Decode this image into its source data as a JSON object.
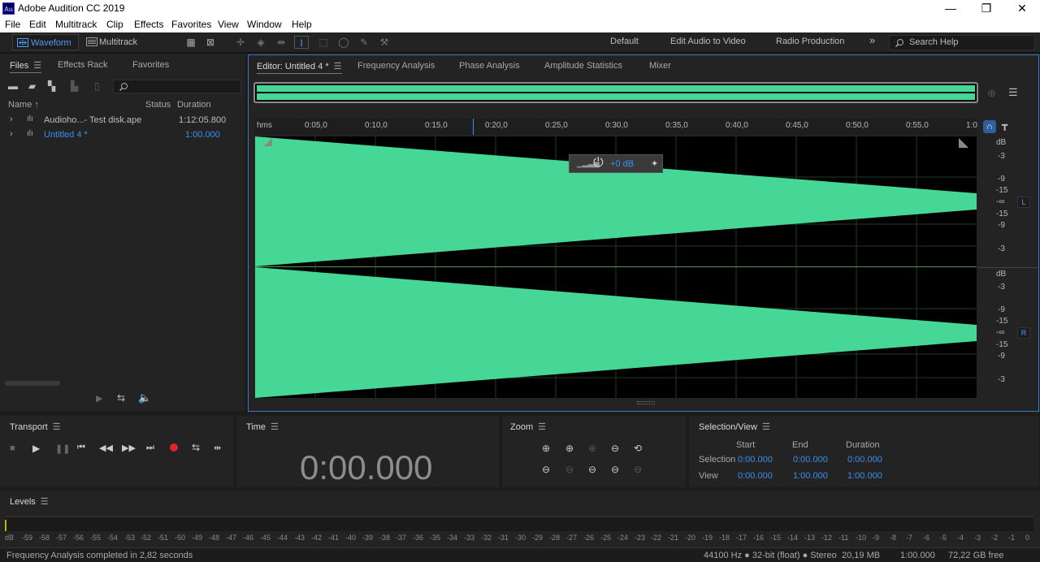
{
  "app": {
    "title": "Adobe Audition CC 2019",
    "icon_text": "Au"
  },
  "window_controls": {
    "minimize": "—",
    "maximize": "❐",
    "close": "✕"
  },
  "menu": [
    "File",
    "Edit",
    "Multitrack",
    "Clip",
    "Effects",
    "Favorites",
    "View",
    "Window",
    "Help"
  ],
  "toolbar": {
    "waveform": "Waveform",
    "multitrack": "Multitrack",
    "workspaces": [
      "Default",
      "Edit Audio to Video",
      "Radio Production"
    ],
    "more": "»",
    "search_placeholder": "Search Help"
  },
  "files_panel": {
    "tabs": [
      "Files",
      "Effects Rack",
      "Favorites"
    ],
    "columns": {
      "name": "Name",
      "status": "Status",
      "duration": "Duration"
    },
    "rows": [
      {
        "name": "Audioho...- Test disk.ape",
        "status": "",
        "duration": "1:12:05.800",
        "active": false
      },
      {
        "name": "Untitled 4 *",
        "status": "",
        "duration": "1:00.000",
        "active": true
      }
    ]
  },
  "editor": {
    "tabs": [
      "Editor: Untitled 4 *",
      "Frequency Analysis",
      "Phase Analysis",
      "Amplitude Statistics",
      "Mixer"
    ],
    "ruler": [
      "hms",
      "0:05,0",
      "0:10,0",
      "0:15,0",
      "0:20,0",
      "0:25,0",
      "0:30,0",
      "0:35,0",
      "0:40,0",
      "0:45,0",
      "0:50,0",
      "0:55,0",
      "1:0"
    ],
    "hud_value": "+0 dB",
    "db_scale_top": [
      "dB",
      "-3",
      "-9",
      "-15",
      "-∞",
      "-15",
      "-9",
      "-3"
    ],
    "db_scale_bottom": [
      "dB",
      "-3",
      "-9",
      "-15",
      "-∞",
      "-15",
      "-9",
      "-3"
    ],
    "channel_left": "L",
    "channel_right": "R",
    "waveform_color": "#46d797"
  },
  "transport": {
    "title": "Transport"
  },
  "time": {
    "title": "Time",
    "value": "0:00.000"
  },
  "zoom": {
    "title": "Zoom"
  },
  "selection_view": {
    "title": "Selection/View",
    "headers": [
      "Start",
      "End",
      "Duration"
    ],
    "rows": [
      {
        "label": "Selection",
        "start": "0:00.000",
        "end": "0:00.000",
        "duration": "0:00.000"
      },
      {
        "label": "View",
        "start": "0:00.000",
        "end": "1:00.000",
        "duration": "1:00.000"
      }
    ]
  },
  "levels": {
    "title": "Levels",
    "scale": [
      "dB",
      "-59",
      "-58",
      "-57",
      "-56",
      "-55",
      "-54",
      "-53",
      "-52",
      "-51",
      "-50",
      "-49",
      "-48",
      "-47",
      "-46",
      "-45",
      "-44",
      "-43",
      "-42",
      "-41",
      "-40",
      "-39",
      "-38",
      "-37",
      "-36",
      "-35",
      "-34",
      "-33",
      "-32",
      "-31",
      "-30",
      "-29",
      "-28",
      "-27",
      "-26",
      "-25",
      "-24",
      "-23",
      "-22",
      "-21",
      "-20",
      "-19",
      "-18",
      "-17",
      "-16",
      "-15",
      "-14",
      "-13",
      "-12",
      "-11",
      "-10",
      "-9",
      "-8",
      "-7",
      "-6",
      "-5",
      "-4",
      "-3",
      "-2",
      "-1",
      "0"
    ]
  },
  "status": {
    "message": "Frequency Analysis completed in 2,82 seconds",
    "format": "44100 Hz ● 32-bit (float) ● Stereo",
    "size": "20,19 MB",
    "duration": "1:00.000",
    "free": "72,22 GB free"
  }
}
